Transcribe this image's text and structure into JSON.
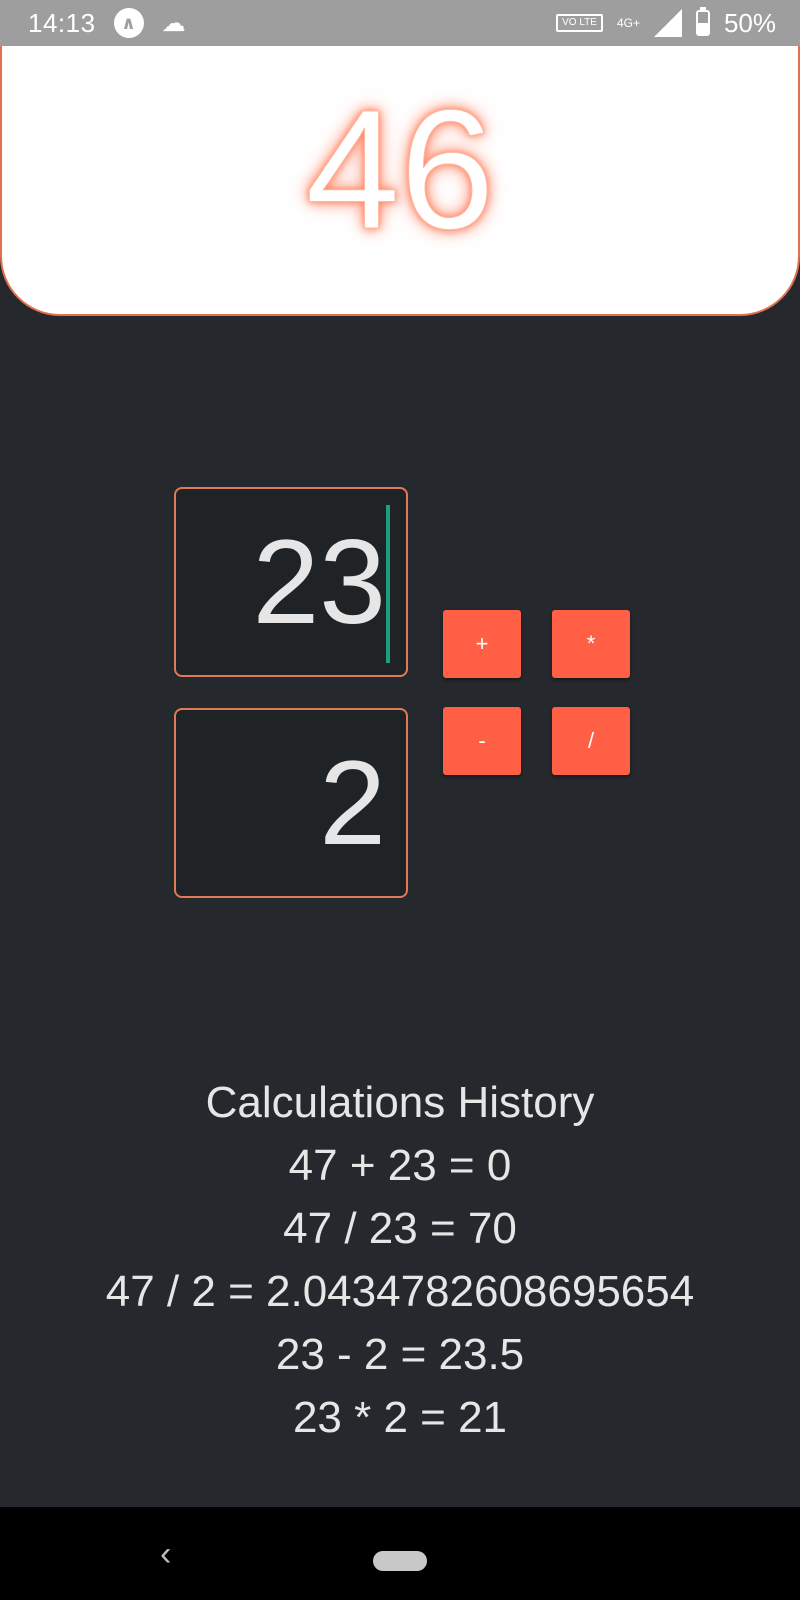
{
  "status_bar": {
    "time": "14:13",
    "icons_left": [
      "app-notification-icon",
      "sync-icon"
    ],
    "volte_label": "VO LTE",
    "network_label": "4G+",
    "battery": "50%"
  },
  "result": {
    "value": "46"
  },
  "inputs": {
    "first_value": "23",
    "second_value": "2"
  },
  "operators": {
    "plus": "+",
    "multiply": "*",
    "minus": "-",
    "divide": "/"
  },
  "history": {
    "title": "Calculations History",
    "items": [
      "47 + 23 = 0",
      "47 / 23 = 70",
      "47 / 2 = 2.0434782608695654",
      "23 - 2 = 23.5",
      "23 * 2 = 21"
    ]
  },
  "nav": {
    "back_glyph": "‹"
  },
  "colors": {
    "background": "#25282c",
    "accent": "#ff5f45",
    "border_accent": "#e07a56",
    "caret": "#1e9e80"
  }
}
